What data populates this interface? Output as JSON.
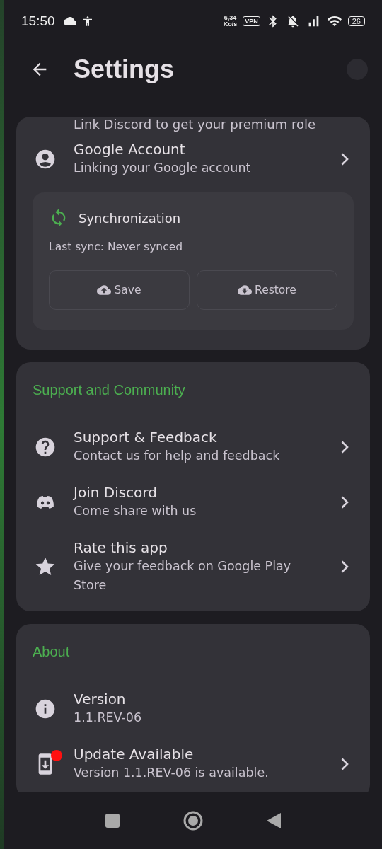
{
  "status_bar": {
    "time": "15:50",
    "speed_value": "6,34",
    "speed_unit": "Ko/s",
    "vpn": "VPN",
    "battery": "26"
  },
  "header": {
    "title": "Settings"
  },
  "sections": [
    {
      "clipped_text": "Link Discord to get your premium role",
      "items": [
        {
          "kind": "account",
          "title": "Google Account",
          "subtitle": "Linking your Google account",
          "chevron": true,
          "badge": false
        }
      ],
      "sync": {
        "title": "Synchronization",
        "status": "Last sync: Never synced",
        "buttons": [
          {
            "kind": "upload",
            "label": "Save"
          },
          {
            "kind": "download",
            "label": "Restore"
          }
        ]
      }
    },
    {
      "title": "Support and Community",
      "items": [
        {
          "kind": "help",
          "title": "Support & Feedback",
          "subtitle": "Contact us for help and feedback",
          "chevron": true,
          "badge": false
        },
        {
          "kind": "discord",
          "title": "Join Discord",
          "subtitle": "Come share with us",
          "chevron": true,
          "badge": false
        },
        {
          "kind": "star",
          "title": "Rate this app",
          "subtitle": "Give your feedback on Google Play Store",
          "chevron": true,
          "badge": false
        }
      ]
    },
    {
      "title": "About",
      "items": [
        {
          "kind": "info",
          "title": "Version",
          "subtitle": "1.1.REV-06",
          "chevron": false,
          "badge": false
        },
        {
          "kind": "update",
          "title": "Update Available",
          "subtitle": "Version 1.1.REV-06 is available.",
          "chevron": true,
          "badge": true
        }
      ]
    }
  ]
}
